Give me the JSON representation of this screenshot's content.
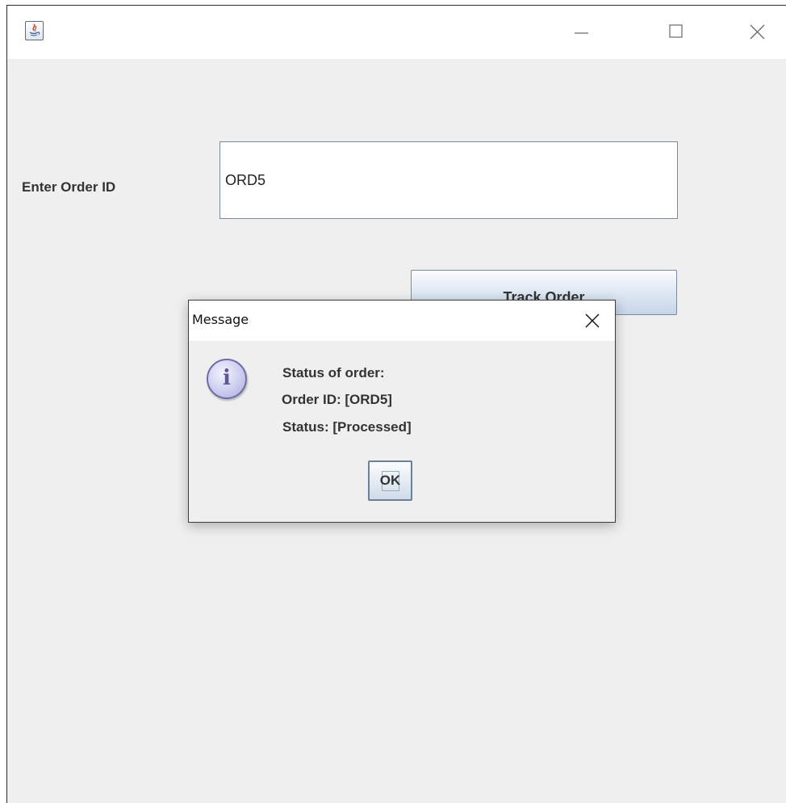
{
  "window": {
    "icon": "java-app-icon",
    "controls": {
      "minimize": "—",
      "maximize": "☐",
      "close": "✕"
    }
  },
  "form": {
    "order_label": "Enter Order ID",
    "order_value": "ORD5",
    "track_button_label": "Track Order"
  },
  "dialog": {
    "title": "Message",
    "icon": "info-icon",
    "icon_glyph": "i",
    "line1": "Status of order:",
    "line2": "Order ID: [ORD5]",
    "line3": "Status: [Processed]",
    "ok_label": "OK"
  }
}
